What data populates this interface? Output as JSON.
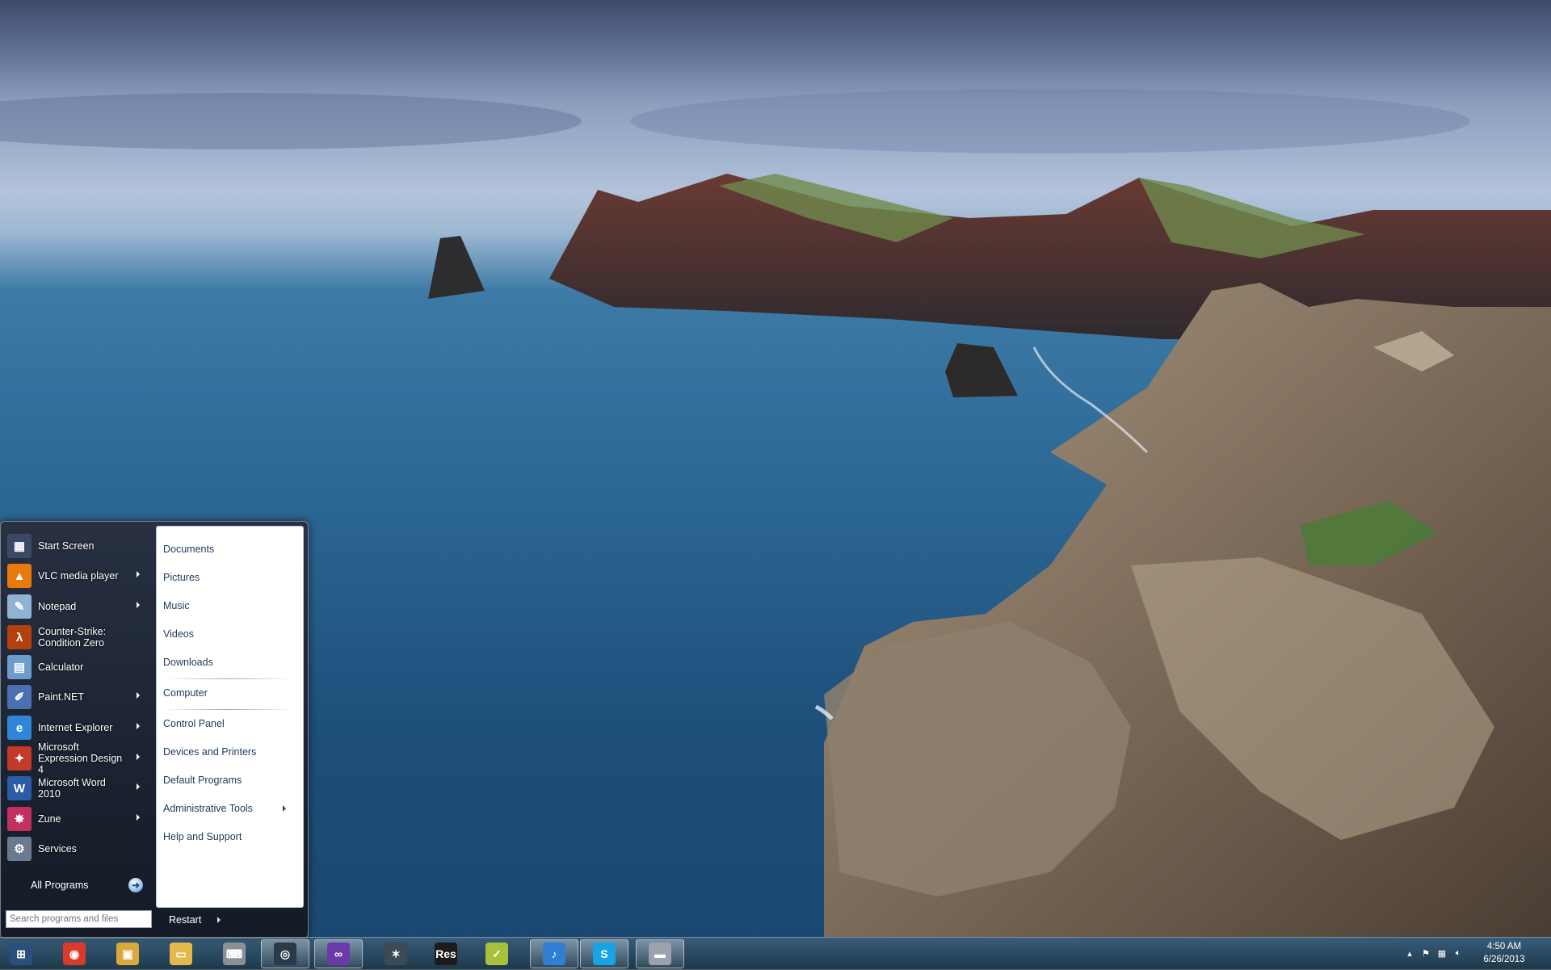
{
  "start_menu": {
    "programs": [
      {
        "label": "Start Screen",
        "icon": "start-screen-icon",
        "color": "#3a4a66",
        "glyph": "▦",
        "has_arrow": false
      },
      {
        "label": "VLC media player",
        "icon": "vlc-icon",
        "color": "#e8790c",
        "glyph": "▲",
        "has_arrow": true
      },
      {
        "label": "Notepad",
        "icon": "notepad-icon",
        "color": "#8fb3d2",
        "glyph": "✎",
        "has_arrow": true
      },
      {
        "label": "Counter-Strike: Condition Zero",
        "icon": "counter-strike-icon",
        "color": "#b3410f",
        "glyph": "λ",
        "has_arrow": false
      },
      {
        "label": "Calculator",
        "icon": "calculator-icon",
        "color": "#6d9ccf",
        "glyph": "▤",
        "has_arrow": false
      },
      {
        "label": "Paint.NET",
        "icon": "paint-net-icon",
        "color": "#4a6fb3",
        "glyph": "✐",
        "has_arrow": true
      },
      {
        "label": "Internet Explorer",
        "icon": "internet-explorer-icon",
        "color": "#2f86d6",
        "glyph": "e",
        "has_arrow": true
      },
      {
        "label": "Microsoft Expression Design 4",
        "icon": "expression-design-icon",
        "color": "#c23a2a",
        "glyph": "✦",
        "has_arrow": true
      },
      {
        "label": "Microsoft Word 2010",
        "icon": "word-icon",
        "color": "#2a5caa",
        "glyph": "W",
        "has_arrow": true
      },
      {
        "label": "Zune",
        "icon": "zune-icon",
        "color": "#c2305f",
        "glyph": "✸",
        "has_arrow": true
      },
      {
        "label": "Services",
        "icon": "services-gear-icon",
        "color": "#6b7b8f",
        "glyph": "⚙",
        "has_arrow": false
      }
    ],
    "all_programs": "All Programs",
    "search_placeholder": "Search programs and files",
    "places_group1": [
      "Documents",
      "Pictures",
      "Music",
      "Videos",
      "Downloads"
    ],
    "places_group2": [
      "Computer"
    ],
    "places_group3": [
      "Control Panel",
      "Devices and Printers",
      "Default Programs",
      "Administrative Tools",
      "Help and Support"
    ],
    "restart_label": "Restart"
  },
  "taskbar": {
    "pinned": [
      {
        "name": "start-orb",
        "icon": "windows-logo-icon",
        "color": "#2a4f7a",
        "glyph": "⊞",
        "active": false
      },
      {
        "name": "chrome",
        "icon": "chrome-icon",
        "color": "#d93a2b",
        "glyph": "◉",
        "active": false
      },
      {
        "name": "explorer-library",
        "icon": "library-icon",
        "color": "#d9a93b",
        "glyph": "▣",
        "active": false
      },
      {
        "name": "windows-explorer",
        "icon": "folder-icon",
        "color": "#e5b84a",
        "glyph": "▭",
        "active": false
      },
      {
        "name": "remote-app",
        "icon": "laptop-icon",
        "color": "#8a8f98",
        "glyph": "⌨",
        "active": false
      },
      {
        "name": "steam",
        "icon": "steam-icon",
        "color": "#2a3a4a",
        "glyph": "◎",
        "active": true
      },
      {
        "name": "visual-studio",
        "icon": "visual-studio-icon",
        "color": "#6a3aa8",
        "glyph": "∞",
        "active": true
      },
      {
        "name": "spider-app",
        "icon": "spider-icon",
        "color": "#3c4a55",
        "glyph": "✶",
        "active": false
      },
      {
        "name": "resmon",
        "icon": "resmon-icon",
        "color": "#1b1b1b",
        "glyph": "Res",
        "active": false
      },
      {
        "name": "task-notes",
        "icon": "notes-icon",
        "color": "#a7c23a",
        "glyph": "✓",
        "active": false
      },
      {
        "name": "itunes",
        "icon": "itunes-icon",
        "color": "#2f7fd4",
        "glyph": "♪",
        "active": true
      },
      {
        "name": "skype",
        "icon": "skype-icon",
        "color": "#18a3e6",
        "glyph": "S",
        "active": true
      },
      {
        "name": "remote-desktop",
        "icon": "remote-desktop-icon",
        "color": "#9aa3ad",
        "glyph": "▬",
        "active": true
      }
    ],
    "tray": {
      "time": "4:50 AM",
      "date": "6/26/2013"
    }
  }
}
